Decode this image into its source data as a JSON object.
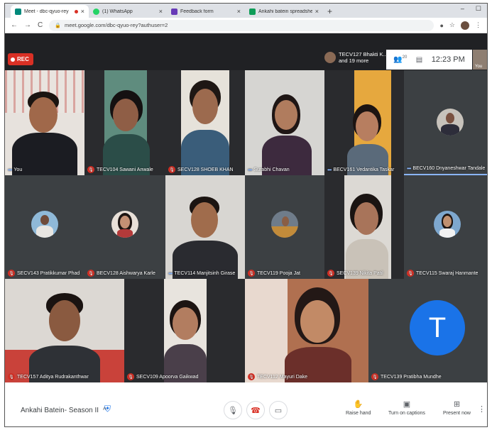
{
  "browser": {
    "tabs": [
      {
        "title": "Meet - dbc-qyuo-rey",
        "favicon": "#00897b"
      },
      {
        "title": "(1) WhatsApp",
        "favicon": "#25d366"
      },
      {
        "title": "Feedback form",
        "favicon": "#673ab7"
      },
      {
        "title": "Ankahi batein spreadsheet - Goo",
        "favicon": "#0f9d58"
      }
    ],
    "url": "meet.google.com/dbc-qyuo-rey?authuser=2"
  },
  "meet": {
    "rec_label": "REC",
    "presenter": {
      "line1": "TECV127 Bhakti K...",
      "line2": "and 19 more"
    },
    "participant_count": "20",
    "time": "12:23 PM",
    "self_label": "You",
    "meeting_name": "Ankahi Batein- Season II",
    "participants": [
      {
        "name": "You",
        "muted": false
      },
      {
        "name": "TECV104 Sawani Anwale",
        "muted": true
      },
      {
        "name": "SECV128 SHOEB KHAN",
        "muted": true
      },
      {
        "name": "Surabhi Chavan",
        "muted": false
      },
      {
        "name": "BECV161 Vedantika Taskar",
        "muted": false
      },
      {
        "name": "BECV160 Dnyaneshwar Tandale",
        "muted": false
      },
      {
        "name": "SECV143 Pratikkumar Phad",
        "muted": true
      },
      {
        "name": "BECV128 Aishwarya Karle",
        "muted": true
      },
      {
        "name": "TECV114 Manjitsinh Girase",
        "muted": false
      },
      {
        "name": "TECV119 Pooja Jat",
        "muted": true
      },
      {
        "name": "SECV139 Nikita Patil",
        "muted": true
      },
      {
        "name": "TECV115 Swaraj Hanmante",
        "muted": true
      },
      {
        "name": "TECV157 Aditya Rudrakanthwar",
        "muted": true
      },
      {
        "name": "SECV109 Apoorva Gaikwad",
        "muted": true
      },
      {
        "name": "TECV112 Mayuri Dake",
        "muted": true
      },
      {
        "name": "TECV139 Pratibha Mundhe",
        "muted": true
      }
    ],
    "letter_avatar": "T",
    "actions": {
      "raise_hand": "Raise hand",
      "captions": "Turn on captions",
      "present": "Present now"
    },
    "colors": {
      "rec": "#d93025",
      "accent": "#1a73e8",
      "speaking": "#8ab4f8"
    }
  }
}
